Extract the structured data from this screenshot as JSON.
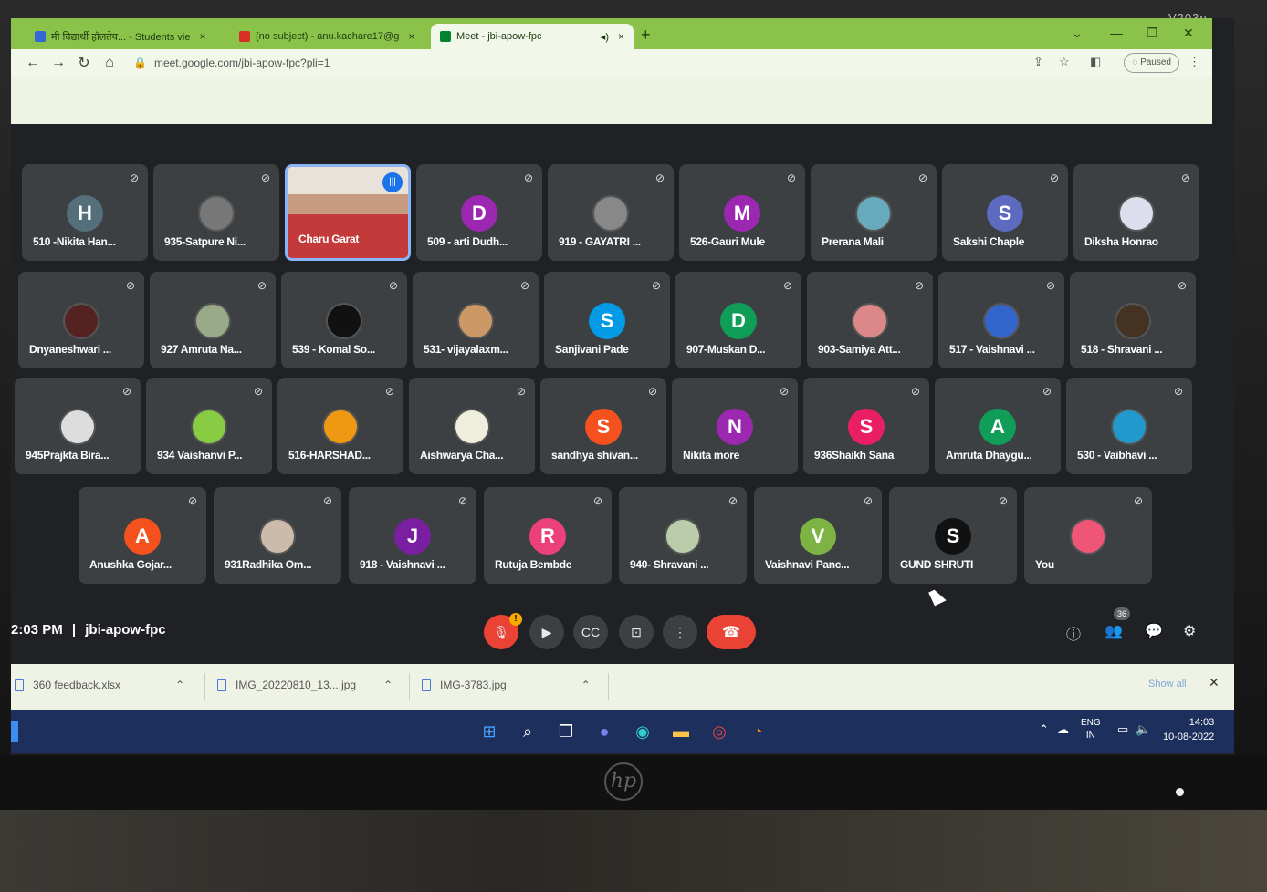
{
  "bezel_label": "V203p",
  "browser": {
    "tabs": [
      {
        "title": "मी विद्यार्थी हॉलतेय... - Students vie",
        "favicon_color": "#3367d6"
      },
      {
        "title": "(no subject) - anu.kachare17@g",
        "favicon_color": "#d93025"
      },
      {
        "title": "Meet - jbi-apow-fpc",
        "favicon_color": "#00832d",
        "speaker": "◂)"
      }
    ],
    "url": "meet.google.com/jbi-apow-fpc?pli=1",
    "paused_label": "Paused"
  },
  "participants": [
    {
      "name": "510 -Nikita Han...",
      "initial": "H",
      "color": "#546e7a"
    },
    {
      "name": "935-Satpure Ni...",
      "initial": "",
      "color": "#777"
    },
    {
      "name": "Charu Garat",
      "initial": "",
      "color": "#b97",
      "speaking": true
    },
    {
      "name": "509 - arti Dudh...",
      "initial": "D",
      "color": "#9c27b0"
    },
    {
      "name": "919 - GAYATRI ...",
      "initial": "",
      "color": "#888"
    },
    {
      "name": "526-Gauri Mule",
      "initial": "M",
      "color": "#9c27b0"
    },
    {
      "name": "Prerana Mali",
      "initial": "",
      "color": "#6ab"
    },
    {
      "name": "Sakshi Chaple",
      "initial": "S",
      "color": "#5c6bc0"
    },
    {
      "name": "Diksha Honrao",
      "initial": "",
      "color": "#dde"
    },
    {
      "name": "Dnyaneshwari ...",
      "initial": "",
      "color": "#522"
    },
    {
      "name": "927 Amruta Na...",
      "initial": "",
      "color": "#9a8"
    },
    {
      "name": "539 - Komal So...",
      "initial": "",
      "color": "#111"
    },
    {
      "name": "531- vijayalaxm...",
      "initial": "",
      "color": "#c96"
    },
    {
      "name": "Sanjivani Pade",
      "initial": "S",
      "color": "#039be5"
    },
    {
      "name": "907-Muskan D...",
      "initial": "D",
      "color": "#0f9d58"
    },
    {
      "name": "903-Samiya Att...",
      "initial": "",
      "color": "#d88"
    },
    {
      "name": "517 - Vaishnavi ...",
      "initial": "",
      "color": "#36c"
    },
    {
      "name": "518 - Shravani ...",
      "initial": "",
      "color": "#432"
    },
    {
      "name": "945Prajkta Bira...",
      "initial": "",
      "color": "#ddd"
    },
    {
      "name": "934 Vaishanvi P...",
      "initial": "",
      "color": "#8c4"
    },
    {
      "name": "516-HARSHAD...",
      "initial": "",
      "color": "#e91"
    },
    {
      "name": "Aishwarya Cha...",
      "initial": "",
      "color": "#eed"
    },
    {
      "name": "sandhya shivan...",
      "initial": "S",
      "color": "#f4511e"
    },
    {
      "name": "Nikita more",
      "initial": "N",
      "color": "#9c27b0"
    },
    {
      "name": "936Shaikh Sana",
      "initial": "S",
      "color": "#e91e63"
    },
    {
      "name": "Amruta Dhaygu...",
      "initial": "A",
      "color": "#0f9d58"
    },
    {
      "name": "530 - Vaibhavi ...",
      "initial": "",
      "color": "#29c"
    },
    {
      "name": "Anushka Gojar...",
      "initial": "A",
      "color": "#f4511e"
    },
    {
      "name": "931Radhika Om...",
      "initial": "",
      "color": "#cba"
    },
    {
      "name": "918 - Vaishnavi ...",
      "initial": "J",
      "color": "#7b1fa2"
    },
    {
      "name": "Rutuja Bembde",
      "initial": "R",
      "color": "#ec407a"
    },
    {
      "name": "940- Shravani ...",
      "initial": "",
      "color": "#bca"
    },
    {
      "name": "Vaishnavi Panc...",
      "initial": "V",
      "color": "#7cb342"
    },
    {
      "name": "GUND SHRUTI",
      "initial": "S",
      "color": "#111"
    },
    {
      "name": "You",
      "initial": "",
      "color": "#e57"
    }
  ],
  "meeting": {
    "time": "2:03 PM",
    "separator": "|",
    "code": "jbi-apow-fpc",
    "mic_warning": "!",
    "people_count": "36"
  },
  "downloads": {
    "items": [
      "360 feedback.xlsx",
      "IMG_20220810_13....jpg",
      "IMG-3783.jpg"
    ],
    "show_all": "Show all"
  },
  "taskbar": {
    "lang_top": "ENG",
    "lang_bottom": "IN",
    "time": "14:03",
    "date": "10-08-2022"
  },
  "colors": {
    "tab_strip": "#8bc34a",
    "meet_bg": "#202124",
    "tile_bg": "#3c4043",
    "end_call": "#ea4335",
    "taskbar": "#1d2f5c"
  }
}
